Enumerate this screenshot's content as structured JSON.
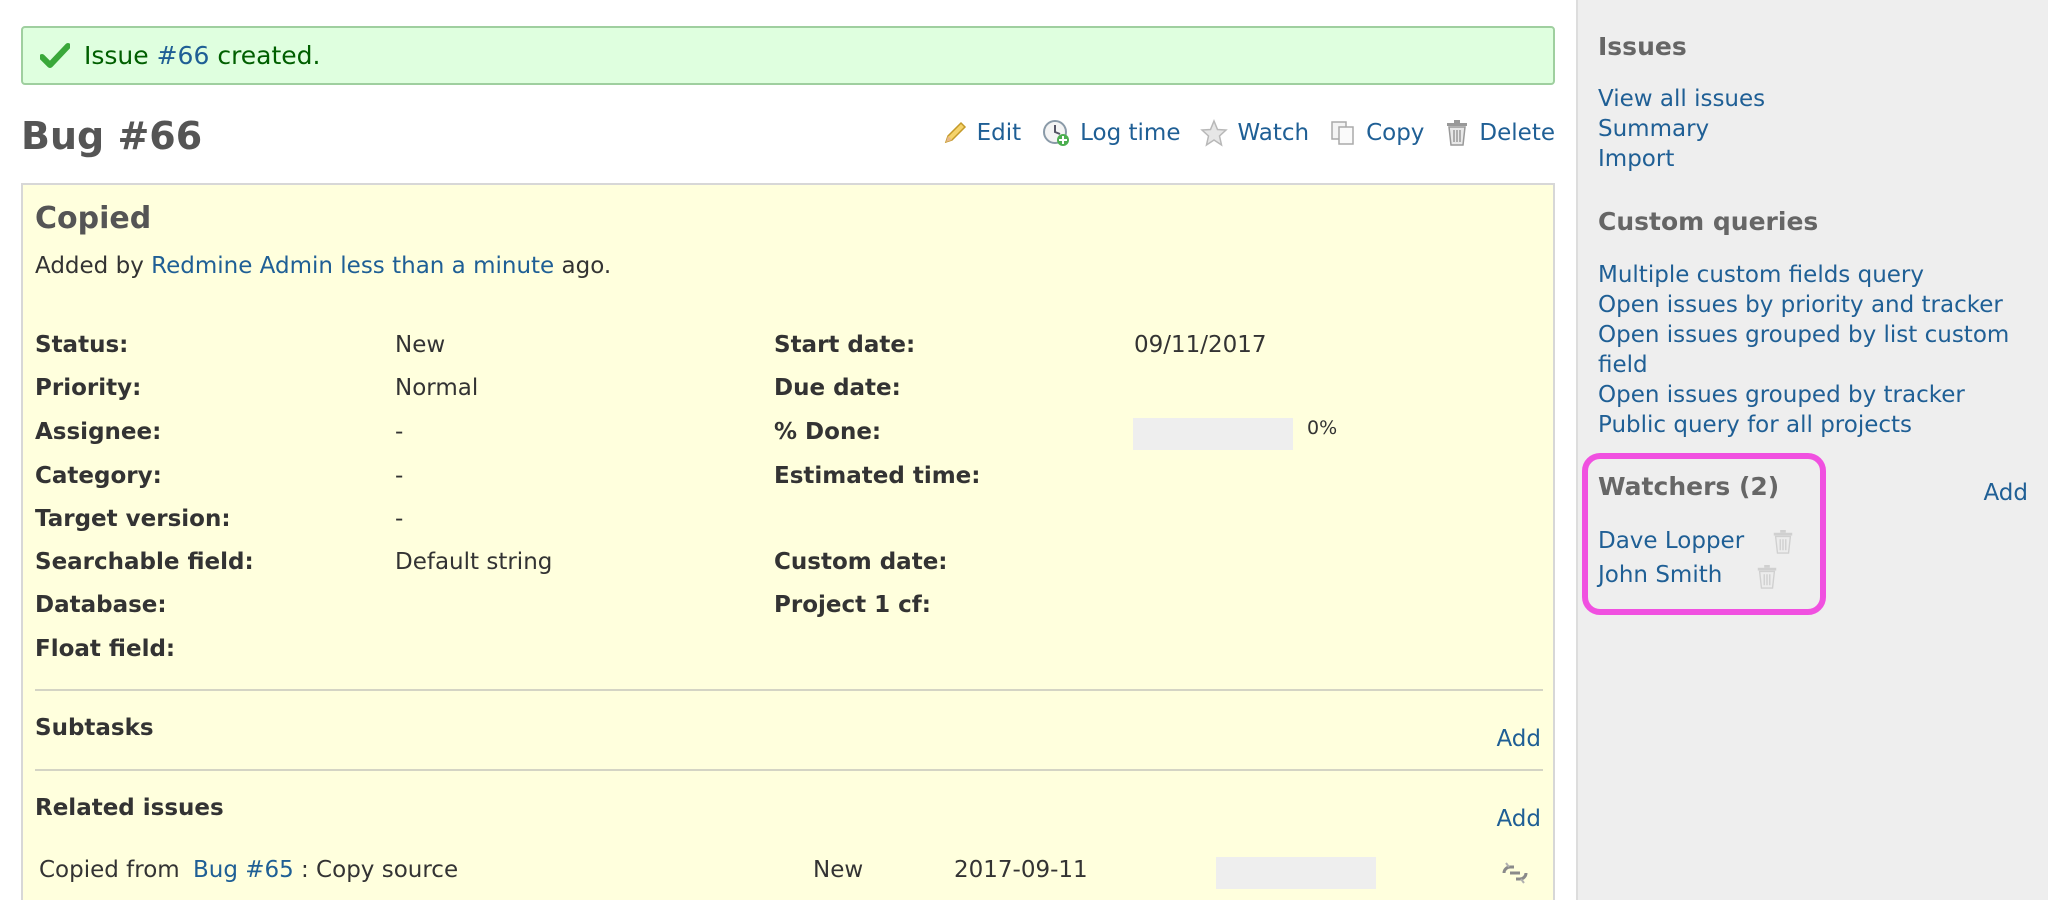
{
  "flash": {
    "prefix": "Issue ",
    "issue_link": "#66",
    "suffix": " created."
  },
  "issue": {
    "title": "Bug #66",
    "subject": "Copied",
    "author_prefix": "Added by ",
    "author": "Redmine Admin",
    "author_sep": " ",
    "age": "less than a minute",
    "author_suffix": " ago."
  },
  "actions": [
    {
      "label": "Edit",
      "icon": "pencil-icon"
    },
    {
      "label": "Log time",
      "icon": "clock-icon"
    },
    {
      "label": "Watch",
      "icon": "star-icon"
    },
    {
      "label": "Copy",
      "icon": "copy-icon"
    },
    {
      "label": "Delete",
      "icon": "trash-icon"
    }
  ],
  "attributes": {
    "status": {
      "label": "Status:",
      "value": "New"
    },
    "priority": {
      "label": "Priority:",
      "value": "Normal"
    },
    "assignee": {
      "label": "Assignee:",
      "value": "-"
    },
    "category": {
      "label": "Category:",
      "value": "-"
    },
    "target_version": {
      "label": "Target version:",
      "value": "-"
    },
    "searchable_field": {
      "label": "Searchable field:",
      "value": "Default string"
    },
    "database": {
      "label": "Database:",
      "value": ""
    },
    "float_field": {
      "label": "Float field:",
      "value": ""
    },
    "start_date": {
      "label": "Start date:",
      "value": "09/11/2017"
    },
    "due_date": {
      "label": "Due date:",
      "value": ""
    },
    "done": {
      "label": "% Done:",
      "value": "0%",
      "ratio": 0
    },
    "estimated_time": {
      "label": "Estimated time:",
      "value": ""
    },
    "custom_date": {
      "label": "Custom date:",
      "value": ""
    },
    "project_cf": {
      "label": "Project 1 cf:",
      "value": ""
    }
  },
  "subtasks": {
    "title": "Subtasks",
    "add_label": "Add"
  },
  "related": {
    "title": "Related issues",
    "add_label": "Add",
    "rows": [
      {
        "prefix": "Copied from ",
        "link": "Bug #65",
        "subject": ": Copy source",
        "status": "New",
        "date": "2017-09-11",
        "done_ratio": 0,
        "icon": "unlink-icon"
      }
    ]
  },
  "sidebar": {
    "issues_heading": "Issues",
    "issue_links": [
      "View all issues",
      "Summary",
      "Import"
    ],
    "queries_heading": "Custom queries",
    "query_links": [
      "Multiple custom fields query",
      "Open issues by priority and tracker",
      "Open issues grouped by list custom field",
      "Open issues grouped by tracker",
      "Public query for all projects"
    ],
    "watchers_heading": "Watchers (2)",
    "watchers_add": "Add",
    "watchers": [
      "Dave Lopper",
      "John Smith"
    ]
  },
  "colors": {
    "link": "#1f5f95",
    "flash_bg": "#dfffdf",
    "issue_bg": "#ffffdd",
    "highlight": "#f050e0"
  }
}
